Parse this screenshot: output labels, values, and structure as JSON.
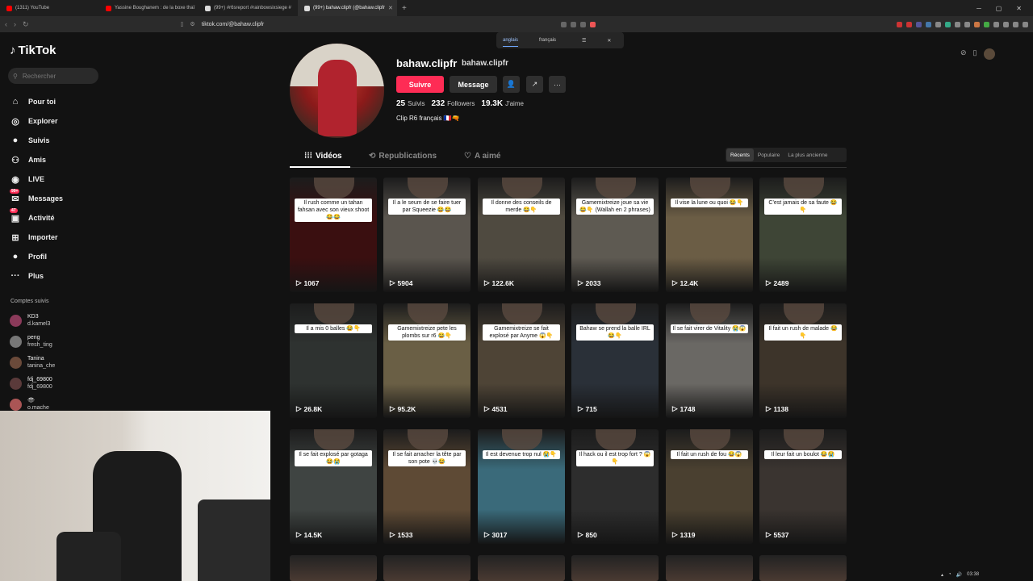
{
  "browser": {
    "tabs": [
      {
        "label": "(1311) YouTube",
        "color": "#ff0000",
        "active": false
      },
      {
        "label": "Yassine Boughanem : de la boxe thaï",
        "color": "#ff0000",
        "active": false
      },
      {
        "label": "(99+) #r6sreport #rainbowsixsiege #",
        "color": "#ffffff",
        "active": false
      },
      {
        "label": "(99+) bahaw.clipfr (@bahaw.clipfr",
        "color": "#ffffff",
        "active": true
      }
    ],
    "url": "tiktok.com/@bahaw.clipfr",
    "translate": {
      "from": "anglais",
      "to": "français"
    }
  },
  "sidebar": {
    "logo": "TikTok",
    "search_placeholder": "Rechercher",
    "menu": [
      {
        "label": "Pour toi",
        "icon": "home-icon",
        "glyph": "⌂"
      },
      {
        "label": "Explorer",
        "icon": "compass-icon",
        "glyph": "◎"
      },
      {
        "label": "Suivis",
        "icon": "following-avatar-icon",
        "glyph": "●"
      },
      {
        "label": "Amis",
        "icon": "friends-icon",
        "glyph": "⚇"
      },
      {
        "label": "LIVE",
        "icon": "live-icon",
        "glyph": "◉"
      },
      {
        "label": "Messages",
        "icon": "messages-icon",
        "glyph": "✉",
        "badge": "99+"
      },
      {
        "label": "Activité",
        "icon": "activity-icon",
        "glyph": "▣",
        "badge": "47"
      },
      {
        "label": "Importer",
        "icon": "upload-icon",
        "glyph": "⊞"
      },
      {
        "label": "Profil",
        "icon": "profile-icon",
        "glyph": "●"
      },
      {
        "label": "Plus",
        "icon": "more-icon",
        "glyph": "···"
      }
    ],
    "follow_title": "Comptes suivis",
    "following": [
      {
        "name": "KD3",
        "handle": "d.kamel3",
        "color": "#8b3a5a"
      },
      {
        "name": "peng",
        "handle": "fresh_ting",
        "color": "#777777"
      },
      {
        "name": "Tanina",
        "handle": "tanina_che",
        "color": "#6b4a3a"
      },
      {
        "name": "fdj_69800",
        "handle": "fdj_69800",
        "color": "#5a3a3a"
      },
      {
        "name": "👁",
        "handle": "o.mache",
        "color": "#aa5555"
      }
    ]
  },
  "profile": {
    "username": "bahaw.clipfr",
    "nickname": "bahaw.clipfr",
    "follow_label": "Suivre",
    "message_label": "Message",
    "stats": [
      {
        "value": "25",
        "label": "Suivis"
      },
      {
        "value": "232",
        "label": "Followers"
      },
      {
        "value": "19.3K",
        "label": "J'aime"
      }
    ],
    "bio": "Clip R6 français 🇫🇷🔫"
  },
  "tabs": {
    "videos": "Vidéos",
    "reposts": "Republications",
    "liked": "A aimé",
    "sort": [
      "Récents",
      "Populaire",
      "La plus ancienne"
    ]
  },
  "videos": [
    {
      "caption": "Il rush comme un tahan fahsan avec son vieux shoot 😂😂",
      "views": "1067",
      "bg": "#3a0f10"
    },
    {
      "caption": "Il a le seum de se faire tuer par Squeezie 😂😂",
      "views": "5904",
      "bg": "#5a554e"
    },
    {
      "caption": "Il donne des conseils de merde 😂👇",
      "views": "122.6K",
      "bg": "#4f4a40"
    },
    {
      "caption": "Gamemixtreize joue sa vie 😂👇 (Wallah en 2 phrases)",
      "views": "2033",
      "bg": "#5e5a52"
    },
    {
      "caption": "Il vise la lune ou quoi 😂👇",
      "views": "12.4K",
      "bg": "#6b5d45"
    },
    {
      "caption": "C'est jamais de sa faute 😂👇",
      "views": "2489",
      "bg": "#3e4536"
    },
    {
      "caption": "Il a mis 0 balles 😂👇",
      "views": "26.8K",
      "bg": "#2e3230"
    },
    {
      "caption": "Gamemixtreize pete les plombs sur r6 😂👇",
      "views": "95.2K",
      "bg": "#6a5f45"
    },
    {
      "caption": "Gamemixtreize se fait explosé par Anyme 😱👇",
      "views": "4531",
      "bg": "#4e4436"
    },
    {
      "caption": "Bahaw se prend la balle IRL 😂👇",
      "views": "715",
      "bg": "#2a3038"
    },
    {
      "caption": "Il se fait virer de Vitality 😭😱",
      "views": "1748",
      "bg": "#6a6864"
    },
    {
      "caption": "Il fait un rush de malade 😂👇",
      "views": "1138",
      "bg": "#3d342a"
    },
    {
      "caption": "Il se fait explosé par gotaga 😂😭",
      "views": "14.5K",
      "bg": "#3f4442"
    },
    {
      "caption": "Il se fait arracher la tête par son pote 💀😂",
      "views": "1533",
      "bg": "#5e4a35"
    },
    {
      "caption": "Il est devenue trop nul 😭👇",
      "views": "3017",
      "bg": "#3a6a7a"
    },
    {
      "caption": "Il hack ou il est trop fort ? 😱👇",
      "views": "850",
      "bg": "#2d2d2d"
    },
    {
      "caption": "Il fait un rush de fou 😂😱",
      "views": "1319",
      "bg": "#4a4030"
    },
    {
      "caption": "Il leur fait un boulot 😂😭",
      "views": "5537",
      "bg": "#3a3430"
    }
  ],
  "clock": "03:38"
}
